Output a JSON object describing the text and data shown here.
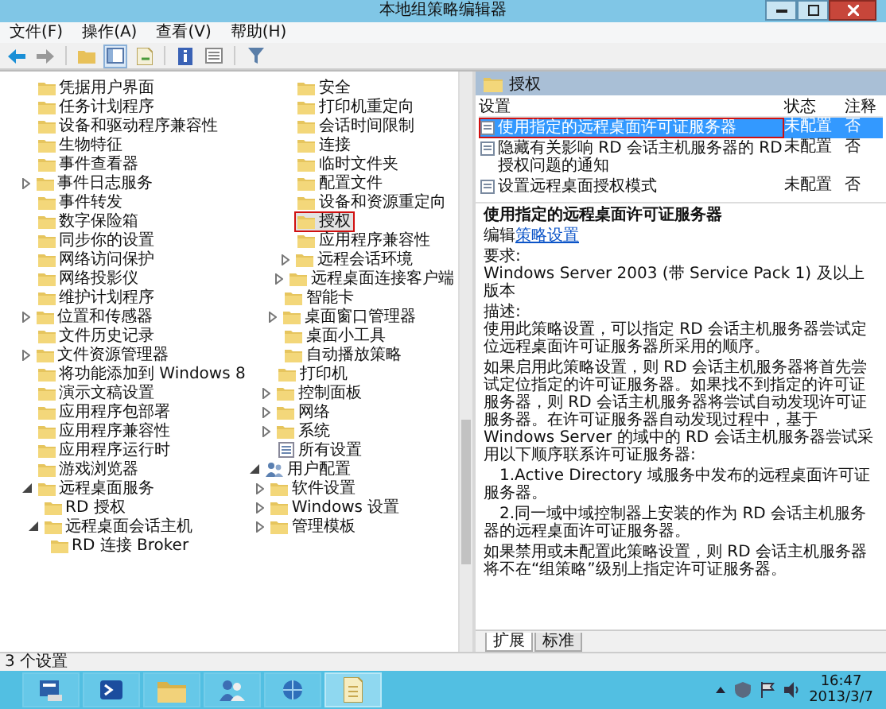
{
  "window": {
    "title": "本地组策略编辑器"
  },
  "menu": [
    {
      "label": "文件(F)"
    },
    {
      "label": "操作(A)"
    },
    {
      "label": "查看(V)"
    },
    {
      "label": "帮助(H)"
    }
  ],
  "tree": [
    {
      "children": [
        {
          "children": [
            {
              "children": [
                {
                  "label": "凭据用户界面",
                  "kind": "folder",
                  "selected": false,
                  "annotated": false
                },
                {
                  "label": "任务计划程序",
                  "kind": "folder",
                  "selected": false,
                  "annotated": false
                },
                {
                  "label": "设备和驱动程序兼容性",
                  "kind": "folder",
                  "selected": false,
                  "annotated": false
                },
                {
                  "label": "生物特征",
                  "kind": "folder",
                  "selected": false,
                  "annotated": false
                },
                {
                  "label": "事件查看器",
                  "kind": "folder",
                  "selected": false,
                  "annotated": false
                },
                {
                  "label": "事件日志服务",
                  "kind": "folder",
                  "expanded": false,
                  "selected": false,
                  "annotated": false
                },
                {
                  "label": "事件转发",
                  "kind": "folder",
                  "selected": false,
                  "annotated": false
                },
                {
                  "label": "数字保险箱",
                  "kind": "folder",
                  "selected": false,
                  "annotated": false
                },
                {
                  "label": "同步你的设置",
                  "kind": "folder",
                  "selected": false,
                  "annotated": false
                },
                {
                  "label": "网络访问保护",
                  "kind": "folder",
                  "selected": false,
                  "annotated": false
                },
                {
                  "label": "网络投影仪",
                  "kind": "folder",
                  "selected": false,
                  "annotated": false
                },
                {
                  "label": "维护计划程序",
                  "kind": "folder",
                  "selected": false,
                  "annotated": false
                },
                {
                  "label": "位置和传感器",
                  "kind": "folder",
                  "expanded": false,
                  "selected": false,
                  "annotated": false
                },
                {
                  "label": "文件历史记录",
                  "kind": "folder",
                  "selected": false,
                  "annotated": false
                },
                {
                  "label": "文件资源管理器",
                  "kind": "folder",
                  "expanded": false,
                  "selected": false,
                  "annotated": false
                },
                {
                  "label": "将功能添加到 Windows 8",
                  "kind": "folder",
                  "selected": false,
                  "annotated": false
                },
                {
                  "label": "演示文稿设置",
                  "kind": "folder",
                  "selected": false,
                  "annotated": false
                },
                {
                  "label": "应用程序包部署",
                  "kind": "folder",
                  "selected": false,
                  "annotated": false
                },
                {
                  "label": "应用程序兼容性",
                  "kind": "folder",
                  "selected": false,
                  "annotated": false
                },
                {
                  "label": "应用程序运行时",
                  "kind": "folder",
                  "selected": false,
                  "annotated": false
                },
                {
                  "label": "游戏浏览器",
                  "kind": "folder",
                  "selected": false,
                  "annotated": false
                },
                {
                  "label": "远程桌面服务",
                  "kind": "folder",
                  "expanded": true,
                  "selected": false,
                  "annotated": false,
                  "children": [
                    {
                      "label": "RD 授权",
                      "kind": "folder",
                      "selected": false,
                      "annotated": false
                    },
                    {
                      "label": "远程桌面会话主机",
                      "kind": "folder",
                      "expanded": true,
                      "selected": false,
                      "annotated": false,
                      "children": [
                        {
                          "label": "RD 连接 Broker",
                          "kind": "folder",
                          "selected": false,
                          "annotated": false
                        },
                        {
                          "label": "安全",
                          "kind": "folder",
                          "selected": false,
                          "annotated": false
                        },
                        {
                          "label": "打印机重定向",
                          "kind": "folder",
                          "selected": false,
                          "annotated": false
                        },
                        {
                          "label": "会话时间限制",
                          "kind": "folder",
                          "selected": false,
                          "annotated": false
                        },
                        {
                          "label": "连接",
                          "kind": "folder",
                          "selected": false,
                          "annotated": false
                        },
                        {
                          "label": "临时文件夹",
                          "kind": "folder",
                          "selected": false,
                          "annotated": false
                        },
                        {
                          "label": "配置文件",
                          "kind": "folder",
                          "selected": false,
                          "annotated": false
                        },
                        {
                          "label": "设备和资源重定向",
                          "kind": "folder",
                          "selected": false,
                          "annotated": false
                        },
                        {
                          "label": "授权",
                          "kind": "folder",
                          "selected": true,
                          "annotated": true
                        },
                        {
                          "label": "应用程序兼容性",
                          "kind": "folder",
                          "selected": false,
                          "annotated": false
                        },
                        {
                          "label": "远程会话环境",
                          "kind": "folder",
                          "expanded": false,
                          "selected": false,
                          "annotated": false
                        }
                      ]
                    },
                    {
                      "label": "远程桌面连接客户端",
                      "kind": "folder",
                      "expanded": false,
                      "selected": false,
                      "annotated": false
                    }
                  ]
                },
                {
                  "label": "智能卡",
                  "kind": "folder",
                  "selected": false,
                  "annotated": false
                },
                {
                  "label": "桌面窗口管理器",
                  "kind": "folder",
                  "expanded": false,
                  "selected": false,
                  "annotated": false
                },
                {
                  "label": "桌面小工具",
                  "kind": "folder",
                  "selected": false,
                  "annotated": false
                },
                {
                  "label": "自动播放策略",
                  "kind": "folder",
                  "selected": false,
                  "annotated": false
                }
              ]
            },
            {
              "label": "打印机",
              "kind": "folder",
              "selected": false,
              "annotated": false
            },
            {
              "label": "控制面板",
              "kind": "folder",
              "expanded": false,
              "selected": false,
              "annotated": false
            },
            {
              "label": "网络",
              "kind": "folder",
              "expanded": false,
              "selected": false,
              "annotated": false
            },
            {
              "label": "系统",
              "kind": "folder",
              "expanded": false,
              "selected": false,
              "annotated": false
            },
            {
              "label": "所有设置",
              "kind": "settings",
              "selected": false,
              "annotated": false
            }
          ]
        }
      ]
    },
    {
      "label": "用户配置",
      "kind": "user",
      "expanded": true,
      "selected": false,
      "annotated": false,
      "children": [
        {
          "label": "软件设置",
          "kind": "folder",
          "expanded": false,
          "selected": false,
          "annotated": false
        },
        {
          "label": "Windows 设置",
          "kind": "folder",
          "expanded": false,
          "selected": false,
          "annotated": false
        },
        {
          "label": "管理模板",
          "kind": "folder",
          "expanded": false,
          "selected": false,
          "annotated": false
        }
      ]
    }
  ],
  "details": {
    "header": "授权",
    "title": "使用指定的远程桌面许可证服务器",
    "edit_prefix": "编辑",
    "edit_link": "策略设置",
    "requirements_label": "要求:",
    "requirements": "Windows Server 2003 (带 Service Pack 1) 及以上版本",
    "description_label": "描述:",
    "paragraphs": [
      {
        "text": "使用此策略设置，可以指定 RD 会话主机服务器尝试定位远程桌面许可证服务器所采用的顺序。",
        "indented": false
      },
      {
        "text": "如果启用此策略设置，则 RD 会话主机服务器将首先尝试定位指定的许可证服务器。如果找不到指定的许可证服务器，则 RD 会话主机服务器将尝试自动发现许可证服务器。在许可证服务器自动发现过程中，基于 Windows Server 的域中的 RD 会话主机服务器尝试采用以下顺序联系许可证服务器:",
        "indented": false
      },
      {
        "text": "1.Active Directory 域服务中发布的远程桌面许可证服务器。",
        "indented": true
      },
      {
        "text": "2.同一域中域控制器上安装的作为 RD 会话主机服务器的远程桌面许可证服务器。",
        "indented": true
      },
      {
        "text": "如果禁用或未配置此策略设置，则 RD 会话主机服务器将不在“组策略”级别上指定许可证服务器。",
        "indented": false
      }
    ]
  },
  "settings": {
    "columns": [
      "设置",
      "状态",
      "注释"
    ],
    "rows": [
      {
        "name": "使用指定的远程桌面许可证服务器",
        "state": "未配置",
        "comment": "否",
        "selected": true,
        "annotated": true
      },
      {
        "name": "隐藏有关影响 RD 会话主机服务器的 RD 授权问题的通知",
        "state": "未配置",
        "comment": "否",
        "selected": false,
        "annotated": false
      },
      {
        "name": "设置远程桌面授权模式",
        "state": "未配置",
        "comment": "否",
        "selected": false,
        "annotated": false
      }
    ]
  },
  "view_tabs": [
    {
      "label": "扩展",
      "selected": true
    },
    {
      "label": "标准",
      "selected": false
    }
  ],
  "status_bar": "3 个设置",
  "taskbar": {
    "time": "16:47",
    "date": "2013/3/7"
  }
}
